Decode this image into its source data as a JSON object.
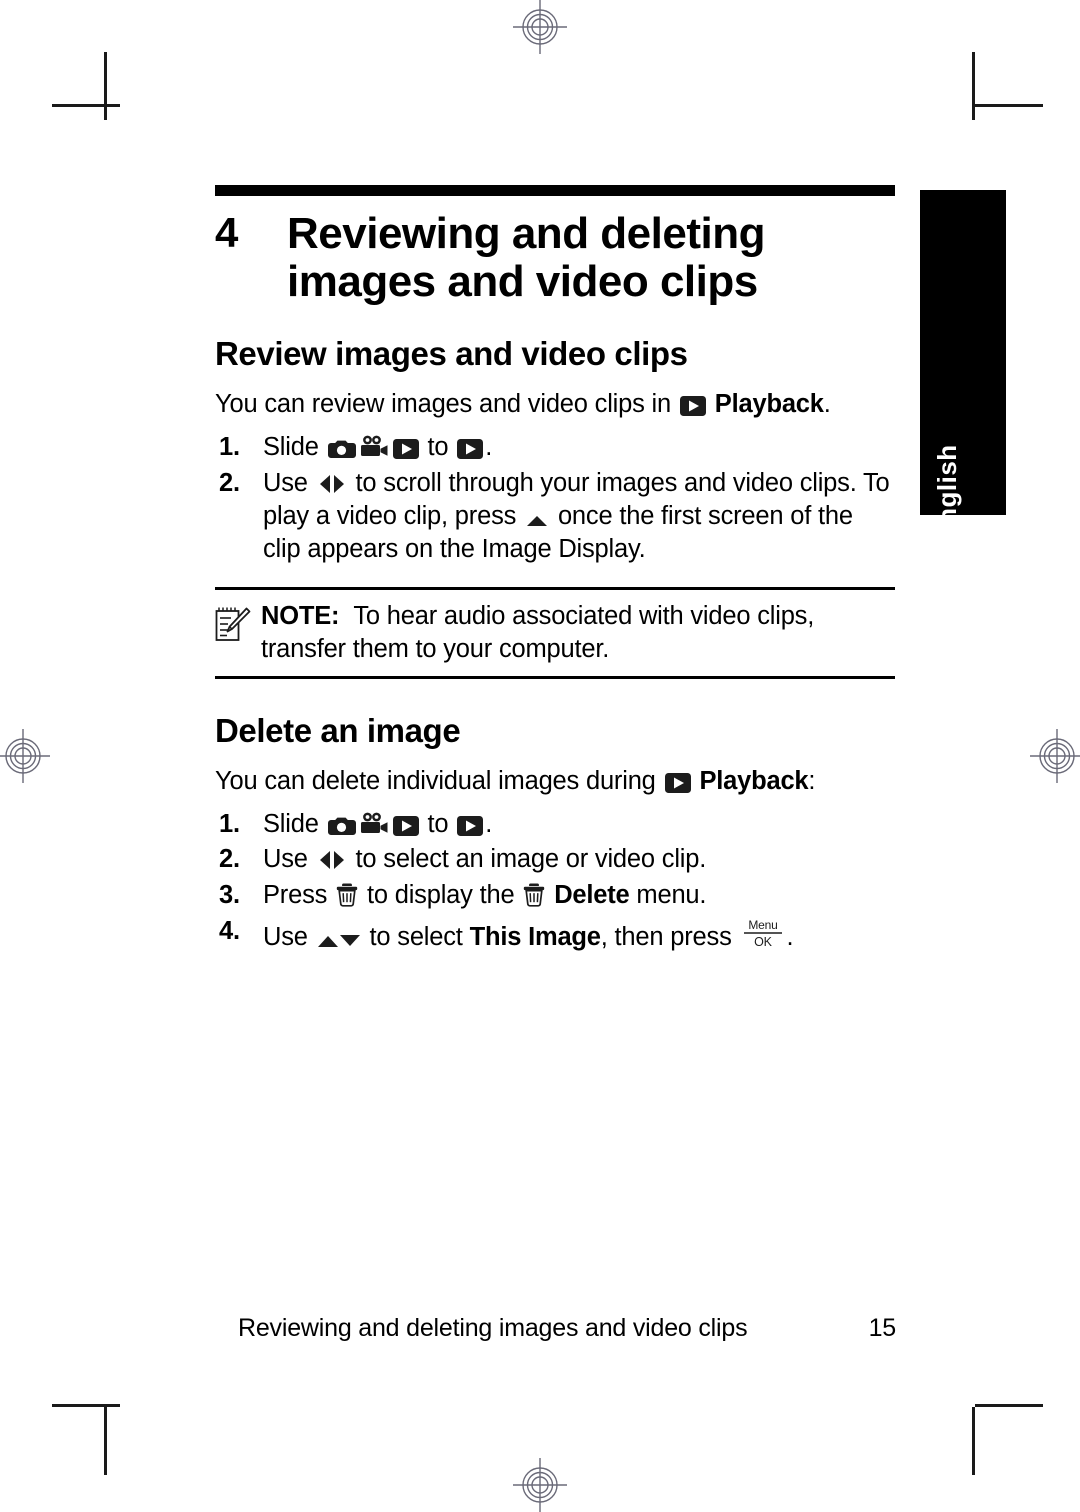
{
  "document": {
    "language_tab": "English",
    "chapter_number": "4",
    "chapter_title_line1": "Reviewing and deleting",
    "chapter_title_line2": "images and video clips"
  },
  "sections": [
    {
      "heading": "Review images and video clips",
      "intro_before_icon": "You can review images and video clips in",
      "intro_icon": "playback-icon",
      "intro_bold": "Playback",
      "intro_after": ".",
      "steps": [
        {
          "number": "1.",
          "parts": [
            {
              "type": "text",
              "value": "Slide "
            },
            {
              "type": "icon",
              "value": "still-camera-icon"
            },
            {
              "type": "icon",
              "value": "video-camera-icon"
            },
            {
              "type": "icon",
              "value": "playback-icon"
            },
            {
              "type": "text",
              "value": " to "
            },
            {
              "type": "icon",
              "value": "playback-icon"
            },
            {
              "type": "text",
              "value": "."
            }
          ]
        },
        {
          "number": "2.",
          "parts": [
            {
              "type": "text",
              "value": "Use "
            },
            {
              "type": "icon",
              "value": "left-right-arrows-icon"
            },
            {
              "type": "text",
              "value": " to scroll through your images and video clips. To play a video clip, press "
            },
            {
              "type": "icon",
              "value": "up-arrow-icon"
            },
            {
              "type": "text",
              "value": " once the first screen of the clip appears on the Image Display."
            }
          ]
        }
      ]
    },
    {
      "heading": "Delete an image",
      "intro_before_icon": "You can delete individual images during",
      "intro_icon": "playback-icon",
      "intro_bold": "Playback",
      "intro_after": ":",
      "steps": [
        {
          "number": "1.",
          "parts": [
            {
              "type": "text",
              "value": "Slide "
            },
            {
              "type": "icon",
              "value": "still-camera-icon"
            },
            {
              "type": "icon",
              "value": "video-camera-icon"
            },
            {
              "type": "icon",
              "value": "playback-icon"
            },
            {
              "type": "text",
              "value": " to "
            },
            {
              "type": "icon",
              "value": "playback-icon"
            },
            {
              "type": "text",
              "value": "."
            }
          ]
        },
        {
          "number": "2.",
          "parts": [
            {
              "type": "text",
              "value": "Use "
            },
            {
              "type": "icon",
              "value": "left-right-arrows-icon"
            },
            {
              "type": "text",
              "value": " to select an image or video clip."
            }
          ]
        },
        {
          "number": "3.",
          "parts": [
            {
              "type": "text",
              "value": "Press "
            },
            {
              "type": "icon",
              "value": "trash-icon"
            },
            {
              "type": "text",
              "value": " to display the "
            },
            {
              "type": "icon",
              "value": "trash-icon"
            },
            {
              "type": "text",
              "value": " "
            },
            {
              "type": "bold",
              "value": "Delete"
            },
            {
              "type": "text",
              "value": " menu."
            }
          ]
        },
        {
          "number": "4.",
          "parts": [
            {
              "type": "text",
              "value": "Use "
            },
            {
              "type": "icon",
              "value": "up-down-arrows-icon"
            },
            {
              "type": "text",
              "value": " to select "
            },
            {
              "type": "bold",
              "value": "This Image"
            },
            {
              "type": "text",
              "value": ", then press "
            },
            {
              "type": "icon",
              "value": "menu-ok-icon"
            },
            {
              "type": "text",
              "value": "."
            }
          ]
        }
      ]
    }
  ],
  "note": {
    "icon": "notepad-pencil-icon",
    "label": "NOTE:",
    "text": "To hear audio associated with video clips, transfer them to your computer."
  },
  "footer": {
    "text": "Reviewing and deleting images and video clips",
    "page_number": "15"
  },
  "colors": {
    "ink": "#000000",
    "paper": "#ffffff",
    "registration_mark": "#6a6a78",
    "crop_mark": "#1a1a1a"
  }
}
